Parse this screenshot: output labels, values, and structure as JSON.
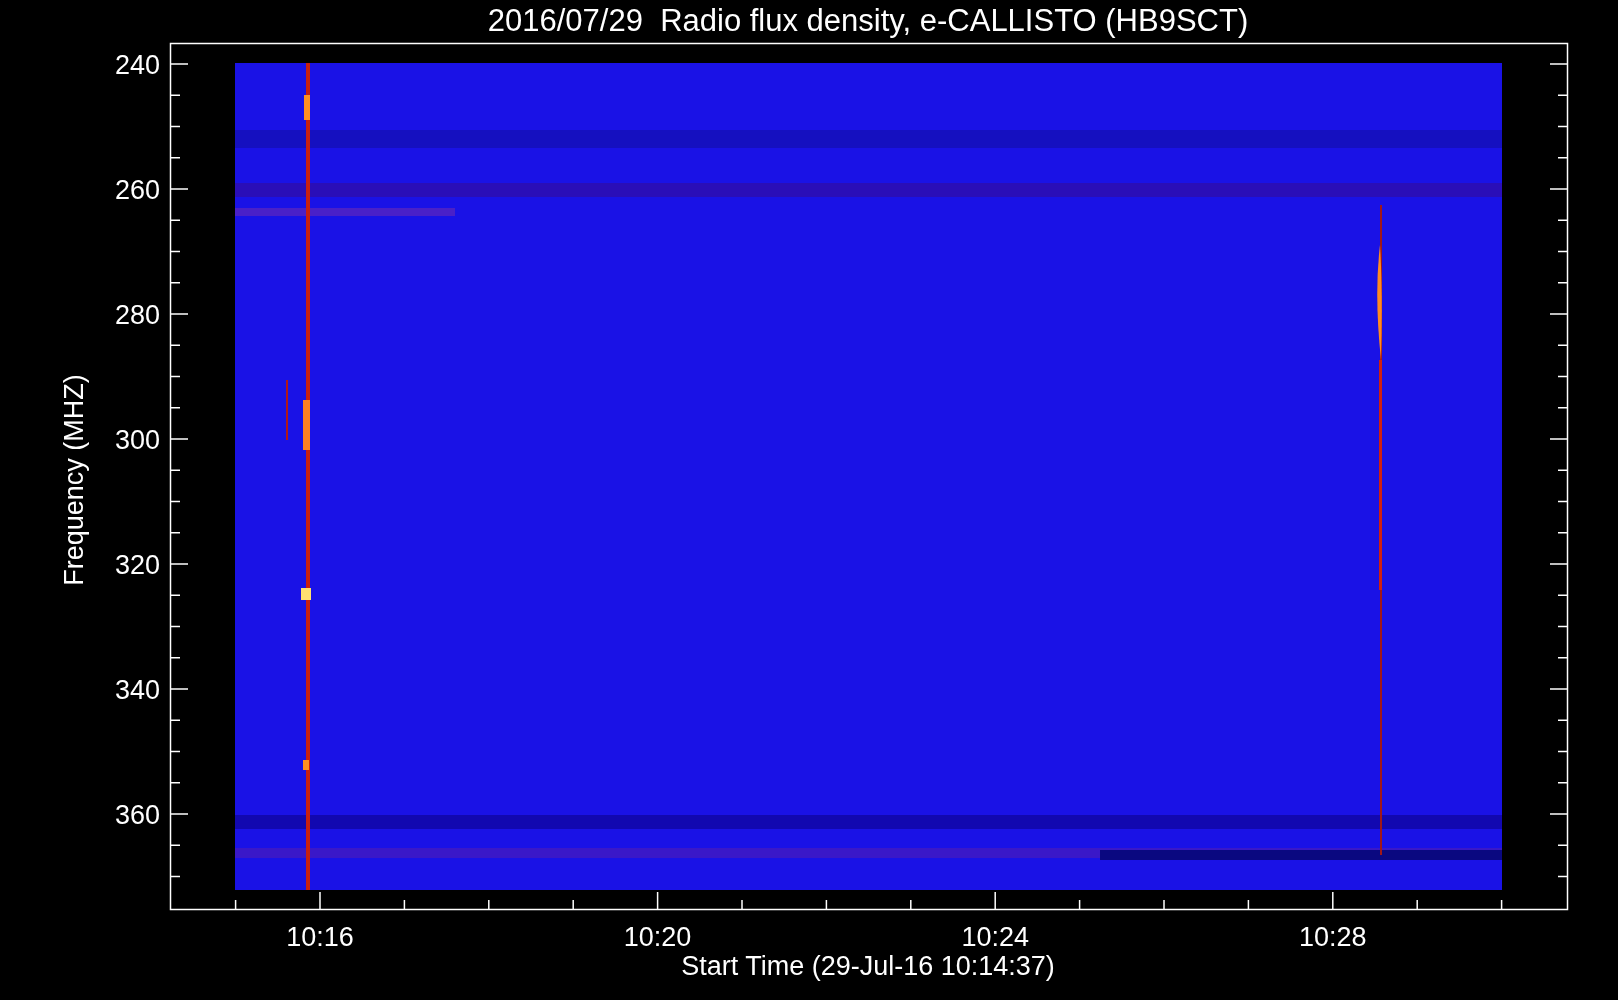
{
  "title": "2016/07/29  Radio flux density, e-CALLISTO (HB9SCT)",
  "y_axis": {
    "label": "Frequency (MHZ)",
    "ticks": [
      "240",
      "260",
      "280",
      "300",
      "320",
      "340",
      "360"
    ]
  },
  "x_axis": {
    "label": "Start Time (29-Jul-16 10:14:37)",
    "ticks": [
      "10:16",
      "10:20",
      "10:24",
      "10:28"
    ]
  }
}
